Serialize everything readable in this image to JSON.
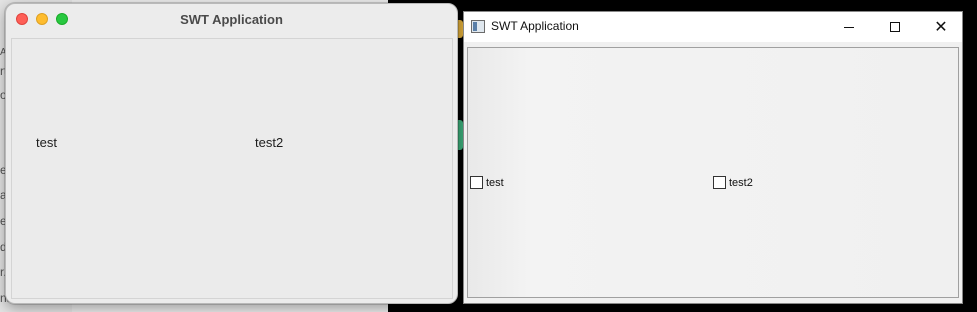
{
  "background": {
    "left_fragments": [
      "A",
      "rt",
      "o",
      "e",
      "a",
      "e",
      "de",
      "r.",
      "ns"
    ]
  },
  "mac_window": {
    "title": "SWT Application",
    "labels": [
      "test",
      "test2"
    ]
  },
  "win_window": {
    "title": "SWT Application",
    "minimize_glyph": "minimize-icon",
    "maximize_glyph": "maximize-icon",
    "close_glyph": "✕",
    "checkboxes": [
      {
        "label": "test",
        "checked": false
      },
      {
        "label": "test2",
        "checked": false
      }
    ]
  },
  "colors": {
    "mac_close": "#fe5f57",
    "mac_minimize": "#febc2e",
    "mac_maximize": "#28c840"
  }
}
